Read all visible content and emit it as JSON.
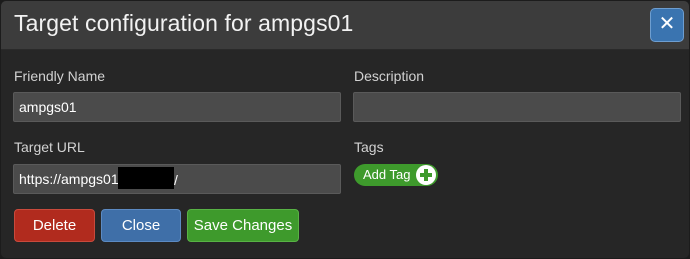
{
  "dialog": {
    "title": "Target configuration for ampgs01",
    "close_glyph": "✕"
  },
  "form": {
    "friendly_name": {
      "label": "Friendly Name",
      "value": "ampgs01"
    },
    "description": {
      "label": "Description",
      "value": ""
    },
    "target_url": {
      "label": "Target URL",
      "value_prefix": "https://ampgs01.",
      "value_suffix": "/"
    },
    "tags": {
      "label": "Tags",
      "add_label": "Add Tag",
      "add_icon": "plus-circle-icon"
    }
  },
  "buttons": {
    "delete": "Delete",
    "close": "Close",
    "save": "Save Changes"
  },
  "colors": {
    "danger": "#b12b1e",
    "primary": "#3f6fa8",
    "success": "#3e9a2c"
  }
}
